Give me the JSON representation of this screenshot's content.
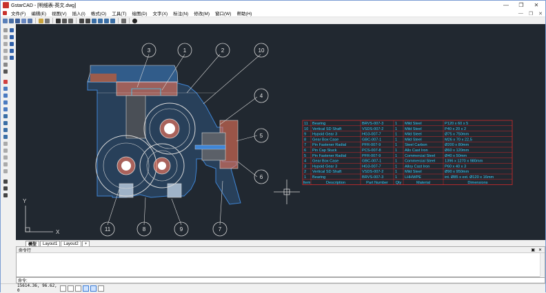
{
  "window": {
    "app_name": "GstarCAD",
    "title": "GstarCAD - [明细表-英文.dwg]",
    "minimize": "—",
    "maximize": "❐",
    "close": "✕"
  },
  "menu": [
    "文件(F)",
    "编辑(E)",
    "视图(V)",
    "插入(I)",
    "格式(O)",
    "工具(T)",
    "绘图(D)",
    "文字(X)",
    "标注(N)",
    "修改(M)",
    "窗口(W)",
    "帮助(H)"
  ],
  "menu_controls": {
    "minimize": "—",
    "restore": "❐",
    "close": "✕"
  },
  "balloons": [
    "3",
    "1",
    "2",
    "10",
    "4",
    "5",
    "6",
    "11",
    "8",
    "9",
    "7"
  ],
  "parts_table": {
    "rows": [
      {
        "item": "11",
        "desc": "Bearing",
        "part": "BRVS-007-3",
        "qty": "1",
        "mat": "Mild Steel",
        "dim": "P120 x 60 x 5"
      },
      {
        "item": "10",
        "desc": "Vertical SD Shaft",
        "part": "VSDS-007-2",
        "qty": "1",
        "mat": "Mild Steel",
        "dim": "P40 x 20 x 2"
      },
      {
        "item": "9",
        "desc": "Hypoid Gear 3",
        "part": "HG3-007-7",
        "qty": "1",
        "mat": "Mild Steel",
        "dim": "Ø75 x 750mm"
      },
      {
        "item": "8",
        "desc": "Gear Box Case",
        "part": "GBC-007-1",
        "qty": "1",
        "mat": "Mild Steel",
        "dim": "M26 x 70 x 22,5"
      },
      {
        "item": "7",
        "desc": "Pin Fastener Radial",
        "part": "PFR-007-9",
        "qty": "1",
        "mat": "Steel Carbon",
        "dim": "Ø200 x 80mm"
      },
      {
        "item": "6",
        "desc": "Pin Cap Stuck",
        "part": "PCS-007-8",
        "qty": "1",
        "mat": "Allo Cast Iron",
        "dim": "Ø60 x 120mm"
      },
      {
        "item": "5",
        "desc": "Pin Fastener Radial",
        "part": "PFR-007-9",
        "qty": "1",
        "mat": "Commercial Steel",
        "dim": "Ø40 x 50mm"
      },
      {
        "item": "4",
        "desc": "Gear Box Case",
        "part": "GBC-007-1",
        "qty": "1",
        "mat": "Commercial Steel",
        "dim": "1396 x 1270 x 980mm"
      },
      {
        "item": "3",
        "desc": "Hypoid Gear 3",
        "part": "HG3-007-7",
        "qty": "1",
        "mat": "Alloy Cast Iron",
        "dim": "P60 x 40 x 3"
      },
      {
        "item": "2",
        "desc": "Vertical SD Shaft",
        "part": "VSDS-007-2",
        "qty": "1",
        "mat": "Mild Steel",
        "dim": "Ø90 x 950mm"
      },
      {
        "item": "1",
        "desc": "Bearing",
        "part": "BRVS-007-3",
        "qty": "1",
        "mat": "LHHWPE",
        "dim": "int. Ø85 x ext. Ø120 x 16mm"
      }
    ],
    "header": {
      "item": "Item",
      "desc": "Description",
      "part": "Part Number",
      "qty": "Qty",
      "mat": "Material",
      "dim": "Dimensions"
    }
  },
  "ucs": {
    "x": "X",
    "y": "Y"
  },
  "tabs": [
    "模型",
    "Layout1",
    "Layout2",
    "+"
  ],
  "command": {
    "panel_title": "命令行",
    "prompt": "命令:",
    "pin": "▣",
    "close": "✕"
  },
  "status": {
    "coords": "15614.36,  96.62,  0"
  },
  "colors": {
    "canvas_bg": "#212830",
    "table_border": "#d42b2b",
    "table_text": "#3bd1ff",
    "blueprint": "#3f86d6",
    "hatch": "#ff7a5c",
    "lines": "#d9d9d9"
  }
}
